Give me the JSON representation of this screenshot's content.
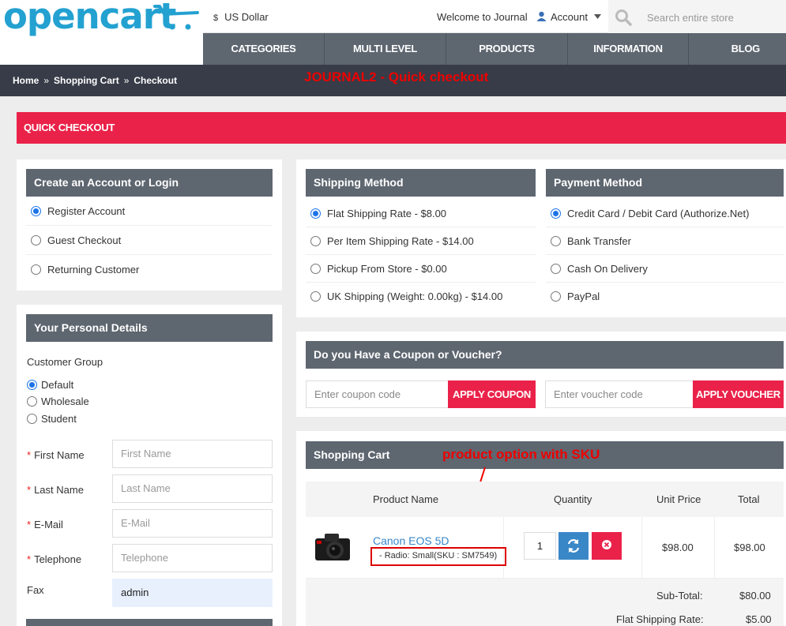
{
  "header": {
    "logo_text": "opencart",
    "currency_symbol": "$",
    "currency_label": "US Dollar",
    "welcome": "Welcome to Journal",
    "account_label": "Account",
    "search_placeholder": "Search entire store",
    "brand_color": "#23a1d1"
  },
  "nav": [
    {
      "label": "CATEGORIES"
    },
    {
      "label": "MULTI LEVEL"
    },
    {
      "label": "PRODUCTS"
    },
    {
      "label": "INFORMATION"
    },
    {
      "label": "BLOG"
    }
  ],
  "breadcrumb": [
    "Home",
    "Shopping Cart",
    "Checkout"
  ],
  "breadcrumb_sep": "»",
  "annotation_title": "JOURNAL2 - Quick checkout",
  "quick_checkout_title": "QUICK CHECKOUT",
  "account_panel": {
    "title": "Create an Account or Login",
    "options": [
      {
        "label": "Register Account",
        "checked": true
      },
      {
        "label": "Guest Checkout",
        "checked": false
      },
      {
        "label": "Returning Customer",
        "checked": false
      }
    ]
  },
  "personal": {
    "title": "Your Personal Details",
    "group_label": "Customer Group",
    "groups": [
      {
        "label": "Default",
        "checked": true
      },
      {
        "label": "Wholesale",
        "checked": false
      },
      {
        "label": "Student",
        "checked": false
      }
    ],
    "fields": [
      {
        "label": "First Name",
        "placeholder": "First Name",
        "required": "*",
        "value": ""
      },
      {
        "label": "Last Name",
        "placeholder": "Last Name",
        "required": "*",
        "value": ""
      },
      {
        "label": "E-Mail",
        "placeholder": "E-Mail",
        "required": "*",
        "value": ""
      },
      {
        "label": "Telephone",
        "placeholder": "Telephone",
        "required": "*",
        "value": ""
      },
      {
        "label": "Fax",
        "placeholder": "",
        "required": "",
        "value": "admin"
      }
    ]
  },
  "shipping": {
    "title": "Shipping Method",
    "options": [
      {
        "label": "Flat Shipping Rate - $8.00",
        "checked": true
      },
      {
        "label": "Per Item Shipping Rate - $14.00",
        "checked": false
      },
      {
        "label": "Pickup From Store - $0.00",
        "checked": false
      },
      {
        "label": "UK Shipping (Weight: 0.00kg) - $14.00",
        "checked": false
      }
    ]
  },
  "payment": {
    "title": "Payment Method",
    "options": [
      {
        "label": "Credit Card / Debit Card (Authorize.Net)",
        "checked": true
      },
      {
        "label": "Bank Transfer",
        "checked": false
      },
      {
        "label": "Cash On Delivery",
        "checked": false
      },
      {
        "label": "PayPal",
        "checked": false
      }
    ]
  },
  "coupon": {
    "title": "Do you Have a Coupon or Voucher?",
    "coupon_placeholder": "Enter coupon code",
    "coupon_button": "APPLY COUPON",
    "voucher_placeholder": "Enter voucher code",
    "voucher_button": "APPLY VOUCHER"
  },
  "cart": {
    "title": "Shopping Cart",
    "annotation": "product option with SKU",
    "columns": [
      "Product Name",
      "Quantity",
      "Unit Price",
      "Total"
    ],
    "item": {
      "name": "Canon EOS 5D",
      "option": "- Radio: Small(SKU : SM7549)",
      "quantity": "1",
      "unit_price": "$98.00",
      "total": "$98.00"
    },
    "totals": [
      {
        "label": "Sub-Total:",
        "value": "$80.00"
      },
      {
        "label": "Flat Shipping Rate:",
        "value": "$5.00"
      }
    ]
  },
  "colors": {
    "accent": "#ea2249",
    "panel_header": "#5e6670",
    "nav": "#5e6670",
    "crumbbar": "#373c48",
    "refresh": "#3a87c8"
  }
}
